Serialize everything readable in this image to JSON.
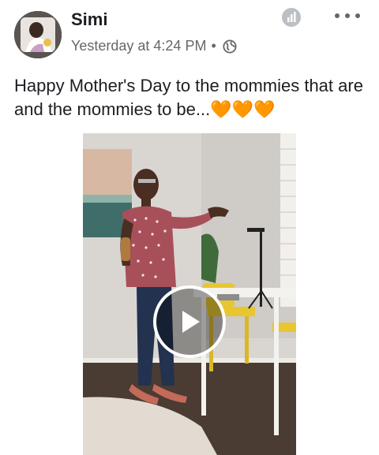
{
  "post": {
    "author": "Simi",
    "timestamp": "Yesterday at 4:24 PM",
    "separator": "•",
    "message": "Happy Mother's Day to the mommies that are and the mommies to be...",
    "emoji": "🧡🧡🧡"
  },
  "icons": {
    "privacy": "globe-icon",
    "insights": "insights-icon",
    "more": "more-options-icon",
    "play": "play-icon"
  },
  "colors": {
    "text": "#1c1e21",
    "meta": "#65676b",
    "heart": "#f7931e"
  }
}
